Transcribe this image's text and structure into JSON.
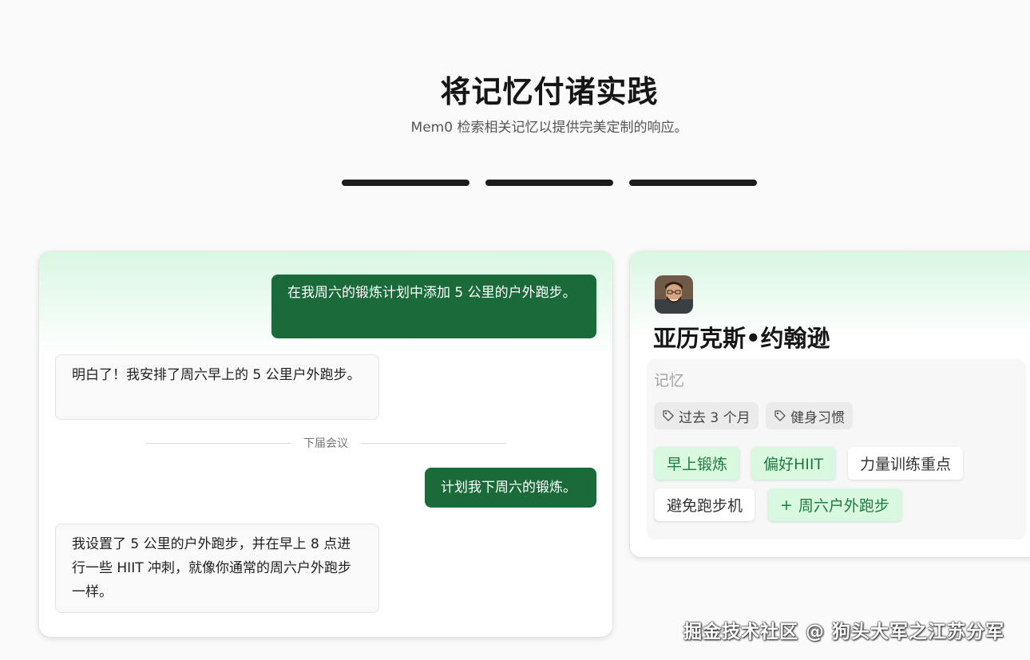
{
  "hero": {
    "title": "将记忆付诸实践",
    "subtitle": "Mem0 检索相关记忆以提供完美定制的响应。"
  },
  "tabs": [
    "",
    "",
    ""
  ],
  "chat": {
    "msg1_user": "在我周六的锻炼计划中添加 5 公里的户外跑步。",
    "msg2_ai": "明白了！我安排了周六早上的 5 公里户外跑步。",
    "divider_label": "下届会议",
    "msg3_user": "计划我下周六的锻炼。",
    "msg4_ai": "我设置了 5 公里的户外跑步，并在早上 8 点进行一些 HIIT 冲刺，就像你通常的周六户外跑步一样。"
  },
  "profile": {
    "name": "亚历克斯•约翰逊",
    "memory_label": "记忆",
    "filters": [
      "过去 3 个月",
      "健身习惯"
    ],
    "tags": [
      "早上锻炼",
      "偏好HIIT",
      "力量训练重点",
      "避免跑步机",
      "周六户外跑步"
    ],
    "new_tag_prefix": "+"
  },
  "colors": {
    "user_bubble": "#1a6b39",
    "tag_green_bg": "#d9f8e0",
    "tag_green_text": "#1e7a3e"
  },
  "icons": [
    "tag-icon",
    "plus-icon"
  ],
  "watermark": "掘金技术社区 @ 狗头大军之江苏分军"
}
